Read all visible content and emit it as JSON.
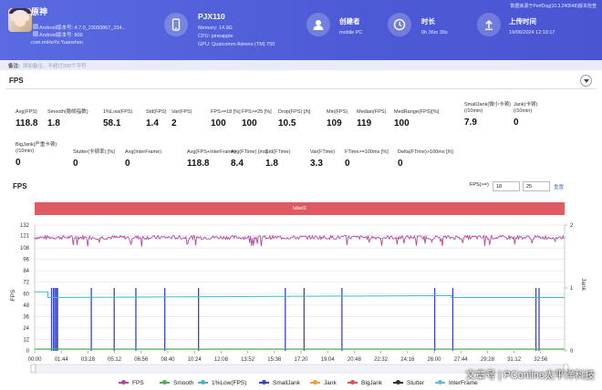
{
  "header": {
    "app_name": "原神",
    "app_version_line": "Android版本号: 4.7.0_23093867_234...",
    "android_code_line": "Android版本号: 809",
    "package": "com.miHoYo.Yuanshen",
    "device_name": "PJX110",
    "memory": "Memory: 14.9G",
    "cpu": "CPU: pineapple",
    "gpu": "GPU: Qualcomm Adreno (TM) 750",
    "creator_label": "创建者",
    "creator_value": "mobile PC",
    "duration_label": "时长",
    "duration_value": "0h 36m 39s",
    "upload_label": "上传时间",
    "upload_value": "19/06/2024 12:19:17",
    "source_note": "数据来源于PerfDog(10.3.240548)版本检查"
  },
  "notes": {
    "label": "备注:",
    "placeholder": "添加备注，不超过200个字符"
  },
  "fps_section": {
    "title": "FPS"
  },
  "stats_row1": [
    {
      "label": "Avg(FPS)",
      "value": "118.8"
    },
    {
      "label": "Smooth(稳帧指数)",
      "value": "1.8"
    },
    {
      "label": "1%Low(FPS)",
      "value": "58.1"
    },
    {
      "label": "Std(FPS)",
      "value": "1.4"
    },
    {
      "label": "Var(FPS)",
      "value": "2"
    },
    {
      "label": "FPS>=18 [%]",
      "value": "100"
    },
    {
      "label": "FPS>=25 [%]",
      "value": "100"
    },
    {
      "label": "Drop(FPS) [/h]",
      "value": "10.5"
    },
    {
      "label": "Min(FPS)",
      "value": "109"
    },
    {
      "label": "Median(FPS)",
      "value": "119"
    },
    {
      "label": "MedRange(FPS)[%]",
      "value": "100"
    },
    {
      "label": "SmallJank(微小卡顿)\n(/10min)",
      "value": "7.9"
    },
    {
      "label": "Jank(卡顿)\n(/10min)",
      "value": "0"
    }
  ],
  "stats_row2": [
    {
      "label": "BigJank(严重卡顿)\n(/10min)",
      "value": "0"
    },
    {
      "label": "Stutter(卡顿率) [%]",
      "value": "0"
    },
    {
      "label": "Avg(InterFrame)",
      "value": "0"
    },
    {
      "label": "Avg(FPS+InterFrame)",
      "value": "118.8"
    },
    {
      "label": "Avg(FTime) [ms]",
      "value": "8.4"
    },
    {
      "label": "Std(FTime)",
      "value": "1.8"
    },
    {
      "label": "Var(FTime)",
      "value": "3.3"
    },
    {
      "label": "FTime>=100ms [%]",
      "value": "0"
    },
    {
      "label": "Delta(FTime)>100ms [/h]",
      "value": "0"
    }
  ],
  "chart_controls": {
    "title": "FPS",
    "fps_label": "FPS(>=)",
    "fps_low": "18",
    "fps_high": "25",
    "reset": "重置",
    "label_bar": "label1"
  },
  "chart_data": {
    "type": "line",
    "ylabel_left": "FPS",
    "ylabel_right": "Jank",
    "ylim_left": [
      0,
      132
    ],
    "y_ticks_left": [
      0,
      12,
      24,
      36,
      48,
      60,
      72,
      84,
      96,
      108,
      121,
      132
    ],
    "ylim_right": [
      0,
      2
    ],
    "y_ticks_right": [
      0,
      1,
      2
    ],
    "x_ticks": [
      "00:00",
      "01:44",
      "03:28",
      "05:12",
      "06:56",
      "08:40",
      "10:24",
      "12:08",
      "13:52",
      "15:36",
      "17:20",
      "19:04",
      "20:48",
      "22:32",
      "24:16",
      "26:00",
      "27:44",
      "29:28",
      "31:12",
      "32:56"
    ],
    "duration_seconds": 2199,
    "series": [
      {
        "name": "FPS",
        "color": "#b5479f",
        "typical": 119,
        "min": 109
      },
      {
        "name": "Smooth",
        "color": "#4caf50",
        "typical": 1.8
      },
      {
        "name": "1%Low(FPS)",
        "color": "#42b6c9",
        "segments": [
          {
            "t_start": 0,
            "t_end": 55,
            "value": 62
          },
          {
            "t_start": 55,
            "t_end": 1730,
            "values_start": 56,
            "values_end": 58
          },
          {
            "t_start": 1730,
            "t_end": 2199,
            "value": 56
          }
        ]
      },
      {
        "name": "SmallJank",
        "color": "#3a46c2",
        "event_times": [
          70,
          78,
          84,
          90,
          95,
          235,
          330,
          420,
          540,
          680,
          1040,
          1118,
          1275,
          1660,
          1735,
          2080,
          2093
        ]
      },
      {
        "name": "Jank",
        "color": "#f0a030"
      },
      {
        "name": "BigJank",
        "color": "#e05050"
      },
      {
        "name": "Stutter",
        "color": "#333333"
      },
      {
        "name": "InterFrame",
        "color": "#5bc0de"
      }
    ]
  },
  "legend": [
    {
      "name": "FPS",
      "color": "#b5479f"
    },
    {
      "name": "Smooth",
      "color": "#4caf50"
    },
    {
      "name": "1%Low(FPS)",
      "color": "#42b6c9"
    },
    {
      "name": "SmallJank",
      "color": "#3a46c2"
    },
    {
      "name": "Jank",
      "color": "#f0a030"
    },
    {
      "name": "BigJank",
      "color": "#e05050"
    },
    {
      "name": "Stutter",
      "color": "#333333"
    },
    {
      "name": "InterFrame",
      "color": "#5bc0de"
    }
  ],
  "watermark": "太平洋科技"
}
